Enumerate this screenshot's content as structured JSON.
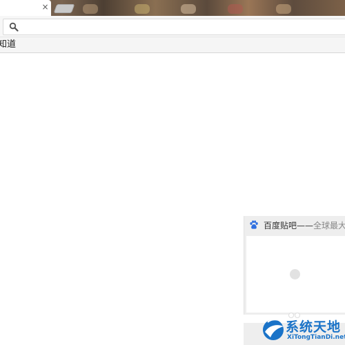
{
  "browser": {
    "tab_close_glyph": "×",
    "address_bar": {
      "value": "",
      "placeholder": ""
    },
    "bookmarks": [
      {
        "label": "知道"
      }
    ]
  },
  "new_tab_page": {
    "tiles": [
      {
        "title": "百度贴吧——",
        "subtitle": "全球最大的",
        "icon": "baidu-paw-icon",
        "loading": true
      }
    ]
  },
  "watermark": {
    "brand": "系统天地",
    "url": "XiTongTianDi.net"
  },
  "colors": {
    "accent": "#1a73c8",
    "baidu_blue": "#2f6fe0"
  }
}
